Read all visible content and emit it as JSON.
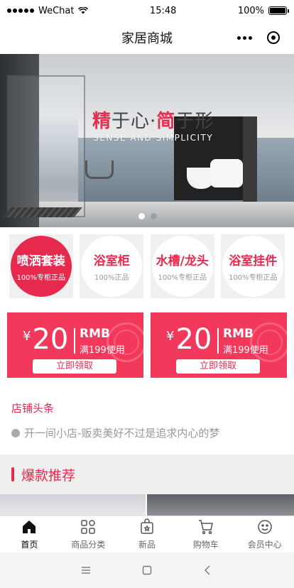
{
  "status": {
    "carrier": "WeChat",
    "time": "15:48",
    "battery": "100%"
  },
  "nav": {
    "title": "家居商城"
  },
  "banner": {
    "headline_part1": "精",
    "headline_part2": "于心",
    "headline_sep": "·",
    "headline_part3": "简",
    "headline_part4": "于形",
    "subtitle": "SENSE AND SIMPLICITY",
    "slide_count": 2,
    "active_slide": 1
  },
  "categories": [
    {
      "title": "喷洒套装",
      "sub": "100%专柜正品",
      "active": true
    },
    {
      "title": "浴室柜",
      "sub": "100%正品",
      "active": false
    },
    {
      "title": "水槽/龙头",
      "sub": "100%专柜正品",
      "active": false
    },
    {
      "title": "浴室挂件",
      "sub": "100%专柜正品",
      "active": false
    }
  ],
  "coupons": [
    {
      "yen": "¥",
      "amount": "20",
      "unit": "RMB",
      "condition": "满199使用",
      "button": "立即领取"
    },
    {
      "yen": "¥",
      "amount": "20",
      "unit": "RMB",
      "condition": "满199使用",
      "button": "立即领取"
    }
  ],
  "news": {
    "title": "店铺头条",
    "line": "开一间小店-贩卖美好不过是追求内心的梦"
  },
  "hot": {
    "title": "爆款推荐"
  },
  "tabs": [
    {
      "label": "首页",
      "icon": "home-icon",
      "active": true
    },
    {
      "label": "商品分类",
      "icon": "category-icon",
      "active": false
    },
    {
      "label": "新品",
      "icon": "new-bag-icon",
      "active": false
    },
    {
      "label": "购物车",
      "icon": "cart-icon",
      "active": false
    },
    {
      "label": "会员中心",
      "icon": "member-face-icon",
      "active": false
    }
  ],
  "colors": {
    "accent": "#e8294e",
    "coupon": "#f3395b"
  }
}
